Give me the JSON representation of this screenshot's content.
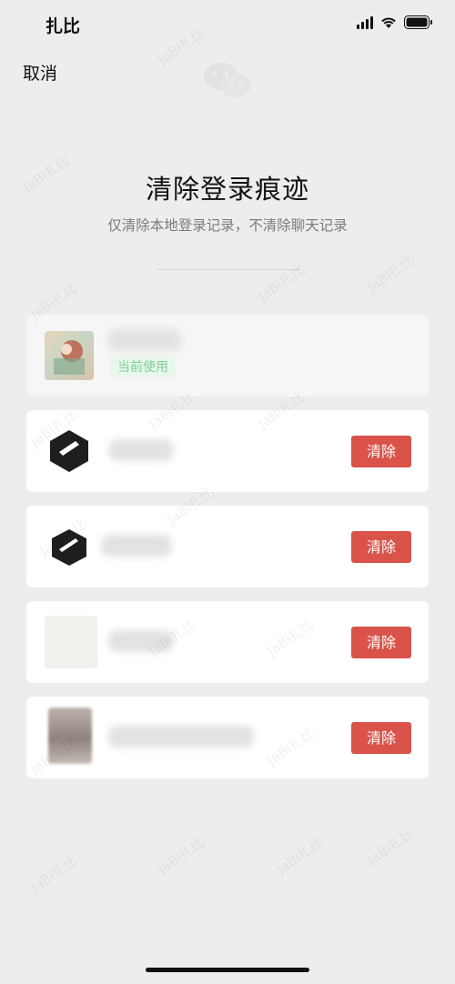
{
  "status_bar": {
    "time": "扎比"
  },
  "nav": {
    "cancel_label": "取消"
  },
  "header": {
    "title": "清除登录痕迹",
    "subtitle": "仅清除本地登录记录，不清除聊天记录"
  },
  "accounts": [
    {
      "badge": "当前使用",
      "avatar_icon": "photo-avatar-icon"
    },
    {
      "button_label": "清除",
      "avatar_icon": "app-logo-icon"
    },
    {
      "button_label": "清除",
      "avatar_icon": "app-logo-icon"
    },
    {
      "button_label": "清除",
      "avatar_icon": "blank-avatar-icon"
    },
    {
      "button_label": "清除",
      "avatar_icon": "blurred-photo-avatar-icon"
    }
  ],
  "watermark": {
    "text": "JaBi扎比"
  },
  "colors": {
    "clear_button": "#d9534a",
    "current_badge_text": "#7fcf94",
    "current_badge_bg": "#e9f6ec",
    "background": "#ededed"
  }
}
